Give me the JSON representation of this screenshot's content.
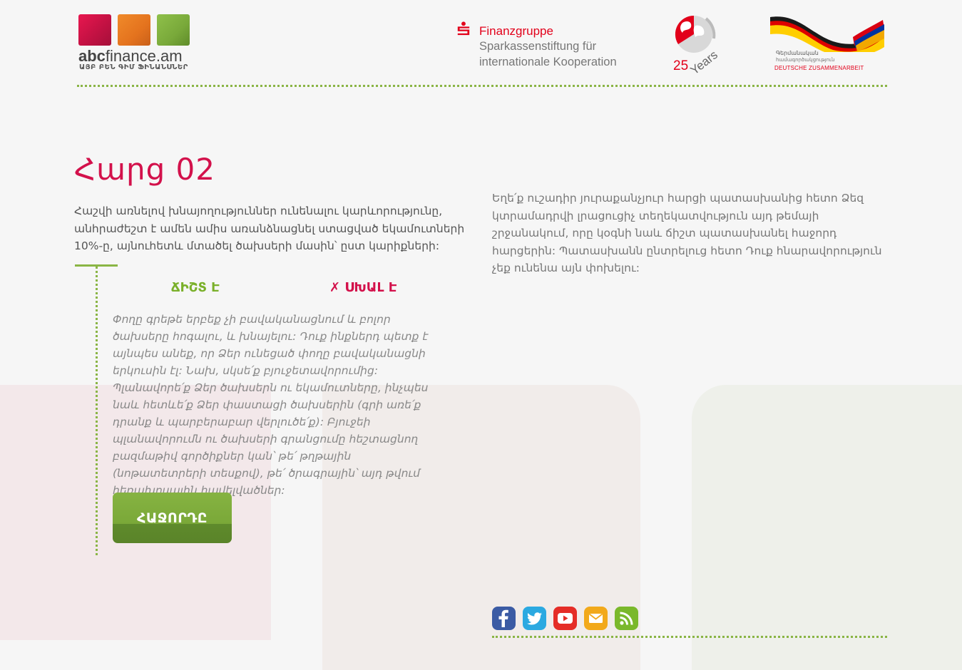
{
  "header": {
    "logo": {
      "name_bold": "abc",
      "name_rest": "finance.am",
      "subtitle": "ԱՅԲ ԲԵՆ ԳԻՄ ՖԻՆԱՆՍՆԵՐ"
    },
    "partner1": {
      "name": "Finanzgruppe",
      "line1": "Sparkassenstiftung für",
      "line2": "internationale Kooperation",
      "brand_color": "#e2001a"
    },
    "partner2": {
      "number": "25",
      "word": "Years"
    },
    "partner3": {
      "line1": "Գերմանական",
      "line2": "համագործակցություն",
      "line3": "DEUTSCHE ZUSAMMENARBEIT"
    }
  },
  "main": {
    "title": "Հարց 02",
    "question": "Հաշվի առնելով խնայողություններ ունենալու կարևորությունը, անհրաժեշտ է ամեն ամիս առանձնացնել ստացված եկամուտների 10%-ը, այնուհետև մտածել ծախսերի մասին՝ ըստ կարիքների:",
    "instructions": "Եղե՛ք ուշադիր յուրաքանչյուր հարցի պատասխանից հետո Ձեզ կտրամադրվի լրացուցիչ տեղեկատվություն այդ թեմայի շրջանակում, որը կօգնի նաև ճիշտ պատասխանել հաջորդ հարցերին: Պատասխանն ընտրելուց հետո Դուք հնարավորություն չեք ունենա այն փոխելու:",
    "options": {
      "correct": "ՃԻՇՏ Է",
      "wrong": "✗ ՍԽԱԼ Է"
    },
    "explanation": "Փողը գրեթե երբեք չի բավականացնում և բոլոր ծախսերը հոգալու, և խնայելու: Դուք ինքներդ պետք է այնպես անեք, որ Ձեր ունեցած փողը բավականացնի երկուսին էլ: Նախ, սկսե՛ք բյուջետավորումից: Պլանավորե՛ք Ձեր ծախսերն ու եկամուտները, ինչպես նաև հետևե՛ք Ձեր փաստացի ծախսերին (գրի առե՛ք դրանք և պարբերաբար վերլուծե՛ք): Բյուջեի պլանավորումն ու ծախսերի գրանցումը հեշտացնող բազմաթիվ գործիքներ կան՝ թե՛ թղթային (նոթատետրերի տեսքով), թե՛ ծրագրային՝ այդ թվում հեռախոսային հավելվածներ:",
    "next_button": "ՀԱՋՈՐԴԸ"
  },
  "footer": {
    "social": [
      {
        "name": "facebook",
        "icon": "facebook-icon",
        "color": "#3b5ba4"
      },
      {
        "name": "twitter",
        "icon": "twitter-icon",
        "color": "#2ba9e1"
      },
      {
        "name": "youtube",
        "icon": "youtube-icon",
        "color": "#e52d27"
      },
      {
        "name": "email",
        "icon": "mail-icon",
        "color": "#f2a91b"
      },
      {
        "name": "rss",
        "icon": "rss-icon",
        "color": "#7ab82b"
      }
    ]
  },
  "colors": {
    "accent_red": "#d3114b",
    "accent_green": "#8ab545",
    "text": "#555555"
  }
}
